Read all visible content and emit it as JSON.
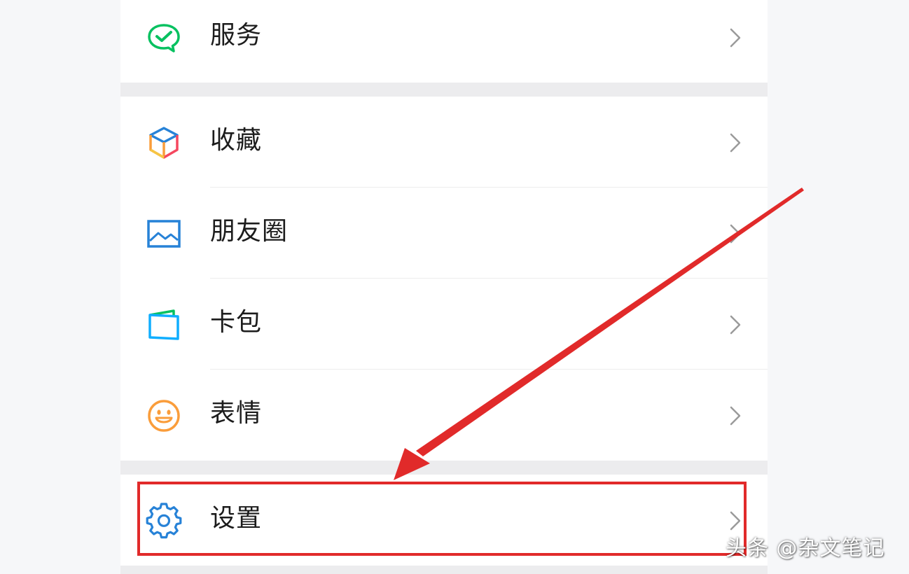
{
  "menu": {
    "items": [
      {
        "label": "服务",
        "icon": "wechat-pay-icon",
        "color": "#07c160"
      },
      {
        "label": "收藏",
        "icon": "cube-icon",
        "color": "#fa9d3b"
      },
      {
        "label": "朋友圈",
        "icon": "photo-album-icon",
        "color": "#2782d7"
      },
      {
        "label": "卡包",
        "icon": "card-wallet-icon",
        "color": "#10aeff"
      },
      {
        "label": "表情",
        "icon": "smiley-icon",
        "color": "#fa9d3b"
      },
      {
        "label": "设置",
        "icon": "gear-icon",
        "color": "#2782d7"
      }
    ]
  },
  "annotation": {
    "highlight_color": "#e12a2a",
    "highlighted_item": "设置"
  },
  "watermark": {
    "text": "头条 @杂文笔记"
  }
}
